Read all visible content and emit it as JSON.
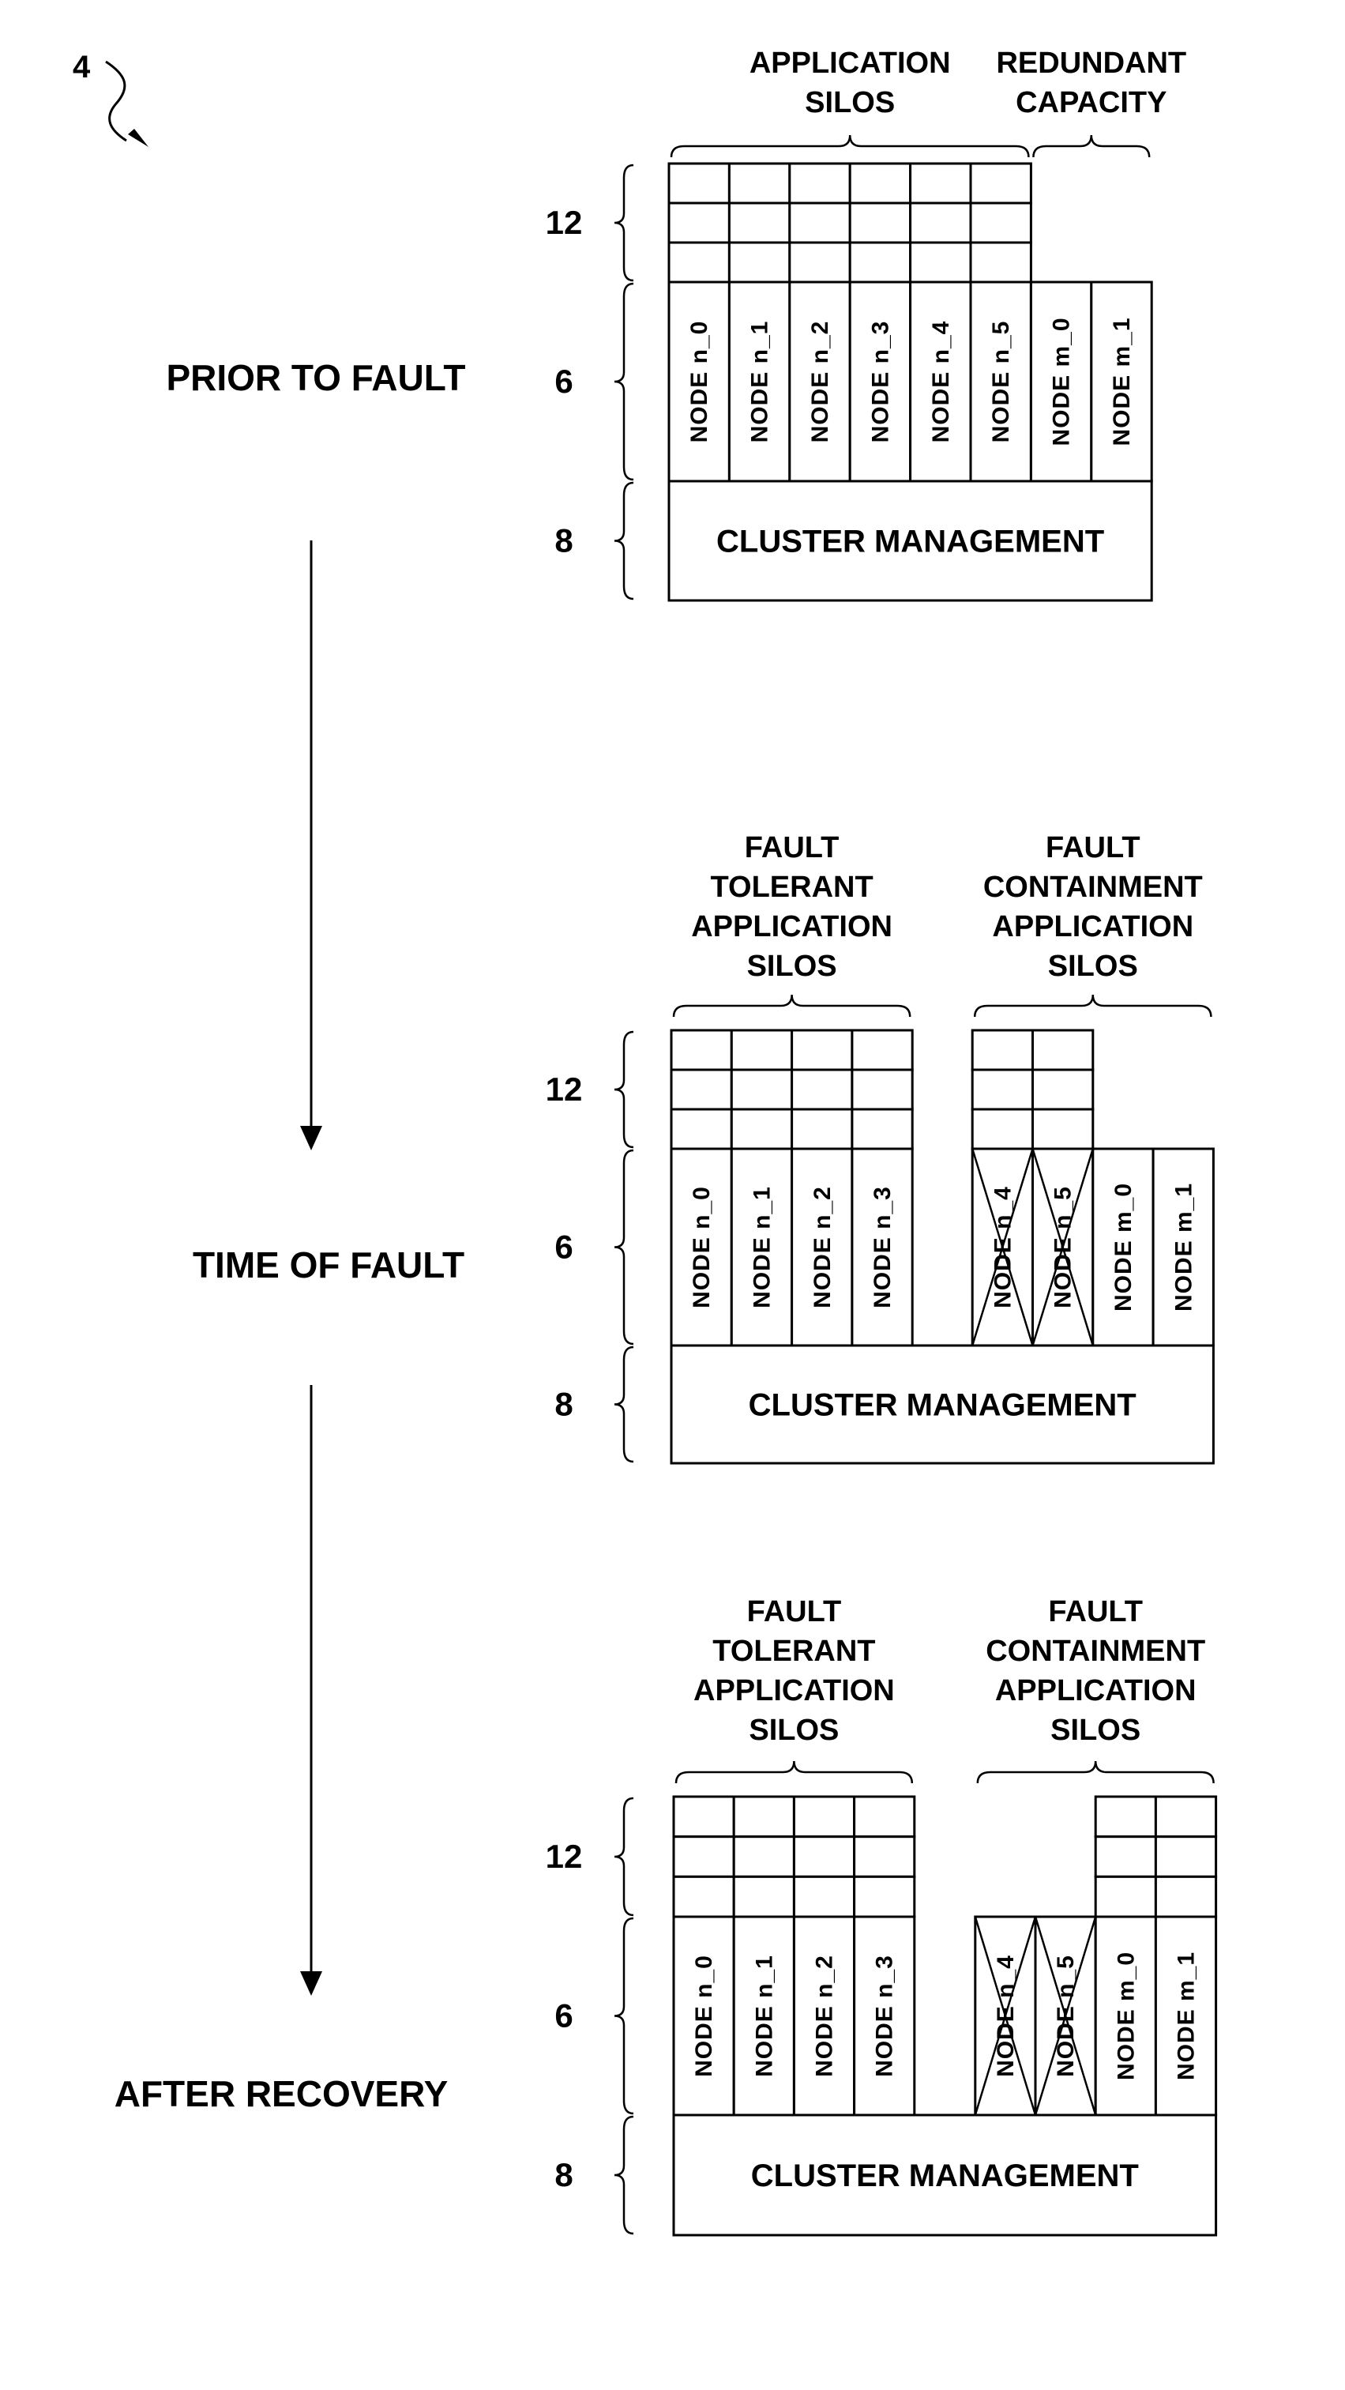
{
  "figure_ref": "4",
  "stages": [
    {
      "label": "PRIOR TO FAULT",
      "groups": [
        {
          "lines": [
            "APPLICATION",
            "SILOS"
          ]
        },
        {
          "lines": [
            "REDUNDANT",
            "CAPACITY"
          ]
        }
      ],
      "nodes": [
        {
          "label": "NODE n_0",
          "silo": true,
          "failed": false
        },
        {
          "label": "NODE n_1",
          "silo": true,
          "failed": false
        },
        {
          "label": "NODE n_2",
          "silo": true,
          "failed": false
        },
        {
          "label": "NODE n_3",
          "silo": true,
          "failed": false
        },
        {
          "label": "NODE n_4",
          "silo": true,
          "failed": false
        },
        {
          "label": "NODE n_5",
          "silo": true,
          "failed": false
        },
        {
          "label": "NODE m_0",
          "silo": false,
          "failed": false
        },
        {
          "label": "NODE m_1",
          "silo": false,
          "failed": false
        }
      ],
      "layer_labels": [
        "12",
        "6",
        "8"
      ],
      "cluster_label": "CLUSTER MANAGEMENT"
    },
    {
      "label": "TIME OF FAULT",
      "groups": [
        {
          "lines": [
            "FAULT",
            "TOLERANT",
            "APPLICATION",
            "SILOS"
          ]
        },
        {
          "lines": [
            "FAULT",
            "CONTAINMENT",
            "APPLICATION",
            "SILOS"
          ]
        }
      ],
      "nodes": [
        {
          "label": "NODE n_0",
          "silo": true,
          "failed": false
        },
        {
          "label": "NODE n_1",
          "silo": true,
          "failed": false
        },
        {
          "label": "NODE n_2",
          "silo": true,
          "failed": false
        },
        {
          "label": "NODE n_3",
          "silo": true,
          "failed": false
        },
        {
          "label": "NODE n_4",
          "silo": true,
          "failed": true
        },
        {
          "label": "NODE n_5",
          "silo": true,
          "failed": true
        },
        {
          "label": "NODE m_0",
          "silo": false,
          "failed": false
        },
        {
          "label": "NODE m_1",
          "silo": false,
          "failed": false
        }
      ],
      "layer_labels": [
        "12",
        "6",
        "8"
      ],
      "cluster_label": "CLUSTER MANAGEMENT"
    },
    {
      "label": "AFTER RECOVERY",
      "groups": [
        {
          "lines": [
            "FAULT",
            "TOLERANT",
            "APPLICATION",
            "SILOS"
          ]
        },
        {
          "lines": [
            "FAULT",
            "CONTAINMENT",
            "APPLICATION",
            "SILOS"
          ]
        }
      ],
      "nodes": [
        {
          "label": "NODE n_0",
          "silo": true,
          "failed": false
        },
        {
          "label": "NODE n_1",
          "silo": true,
          "failed": false
        },
        {
          "label": "NODE n_2",
          "silo": true,
          "failed": false
        },
        {
          "label": "NODE n_3",
          "silo": true,
          "failed": false
        },
        {
          "label": "NODE n_4",
          "silo": false,
          "failed": true
        },
        {
          "label": "NODE n_5",
          "silo": false,
          "failed": true
        },
        {
          "label": "NODE m_0",
          "silo": true,
          "failed": false
        },
        {
          "label": "NODE m_1",
          "silo": true,
          "failed": false
        }
      ],
      "layer_labels": [
        "12",
        "6",
        "8"
      ],
      "cluster_label": "CLUSTER MANAGEMENT"
    }
  ]
}
